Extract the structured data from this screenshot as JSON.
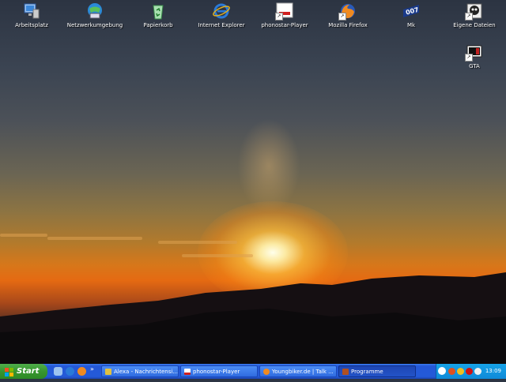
{
  "desktop": {
    "icons": [
      {
        "label": "Arbeitsplatz"
      },
      {
        "label": "Netzwerkumgebung"
      },
      {
        "label": "Papierkorb"
      },
      {
        "label": "Internet Explorer"
      },
      {
        "label": "phonostar-Player"
      },
      {
        "label": "Mozilla Firefox"
      },
      {
        "label": "Mk"
      },
      {
        "label": "Eigene Dateien"
      },
      {
        "label": "GTA"
      }
    ]
  },
  "taskbar": {
    "start_label": "Start",
    "quicklaunch_more": "»",
    "tasks": [
      {
        "label": "Alexa - Nachrichtensi..."
      },
      {
        "label": "phonostar-Player"
      },
      {
        "label": "Youngbiker.de | Talk ..."
      },
      {
        "label": "Programme"
      }
    ],
    "clock": "13:09"
  },
  "icon_badges": {
    "mk": "007"
  },
  "colors": {
    "taskbar": "#245ad8",
    "start": "#37962f",
    "tray": "#0f8ad8"
  }
}
